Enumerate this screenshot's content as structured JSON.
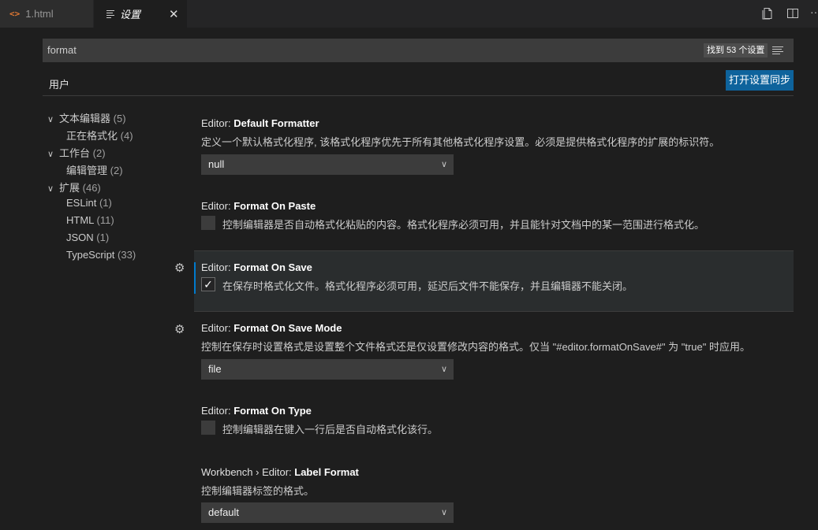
{
  "tabs": [
    {
      "icon": "code-icon",
      "label": "1.html"
    },
    {
      "icon": "settings-lines-icon",
      "label": "设置"
    }
  ],
  "titlebar_icons": [
    "open-settings-json-icon",
    "split-editor-icon",
    "more-actions-icon"
  ],
  "search": {
    "value": "format",
    "result_count": "找到 53 个设置"
  },
  "scope_tab": "用户",
  "sync_button": "打开设置同步",
  "toc": [
    {
      "label": "文本编辑器",
      "count": "(5)",
      "expanded": true
    },
    {
      "label": "正在格式化",
      "count": "(4)"
    },
    {
      "label": "工作台",
      "count": "(2)",
      "expanded": true
    },
    {
      "label": "编辑管理",
      "count": "(2)"
    },
    {
      "label": "扩展",
      "count": "(46)",
      "expanded": true
    },
    {
      "label": "ESLint",
      "count": "(1)"
    },
    {
      "label": "HTML",
      "count": "(11)"
    },
    {
      "label": "JSON",
      "count": "(1)"
    },
    {
      "label": "TypeScript",
      "count": "(33)"
    }
  ],
  "settings": [
    {
      "category": "Editor: ",
      "label": "Default Formatter",
      "description": "定义一个默认格式化程序, 该格式化程序优先于所有其他格式化程序设置。必须是提供格式化程序的扩展的标识符。",
      "type": "dropdown",
      "value": "null"
    },
    {
      "category": "Editor: ",
      "label": "Format On Paste",
      "description": "控制编辑器是否自动格式化粘贴的内容。格式化程序必须可用，并且能针对文档中的某一范围进行格式化。",
      "type": "checkbox",
      "checked": false
    },
    {
      "category": "Editor: ",
      "label": "Format On Save",
      "description": "在保存时格式化文件。格式化程序必须可用，延迟后文件不能保存，并且编辑器不能关闭。",
      "type": "checkbox",
      "checked": true
    },
    {
      "category": "Editor: ",
      "label": "Format On Save Mode",
      "description": "控制在保存时设置格式是设置整个文件格式还是仅设置修改内容的格式。仅当 \"#editor.formatOnSave#\" 为 \"true\" 时应用。",
      "type": "dropdown",
      "value": "file"
    },
    {
      "category": "Editor: ",
      "label": "Format On Type",
      "description": "控制编辑器在键入一行后是否自动格式化该行。",
      "type": "checkbox",
      "checked": false
    },
    {
      "category": "Workbench › Editor: ",
      "label": "Label Format",
      "description": "控制编辑器标签的格式。",
      "type": "dropdown",
      "value": "default"
    }
  ]
}
